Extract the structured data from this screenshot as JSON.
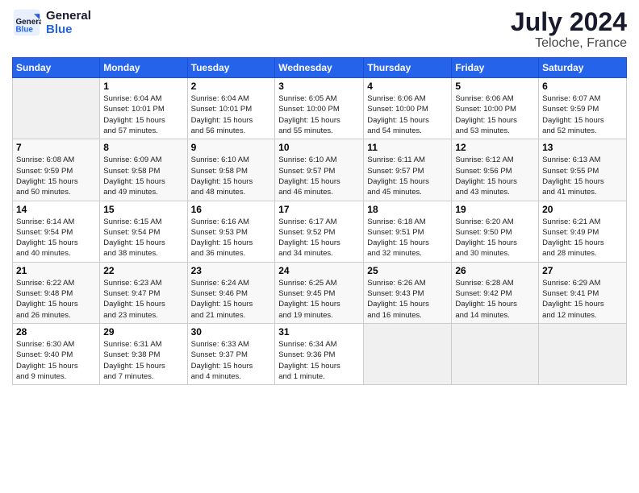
{
  "logo": {
    "line1": "General",
    "line2": "Blue"
  },
  "title": "July 2024",
  "location": "Teloche, France",
  "weekdays": [
    "Sunday",
    "Monday",
    "Tuesday",
    "Wednesday",
    "Thursday",
    "Friday",
    "Saturday"
  ],
  "weeks": [
    [
      {
        "day": "",
        "info": ""
      },
      {
        "day": "1",
        "info": "Sunrise: 6:04 AM\nSunset: 10:01 PM\nDaylight: 15 hours\nand 57 minutes."
      },
      {
        "day": "2",
        "info": "Sunrise: 6:04 AM\nSunset: 10:01 PM\nDaylight: 15 hours\nand 56 minutes."
      },
      {
        "day": "3",
        "info": "Sunrise: 6:05 AM\nSunset: 10:00 PM\nDaylight: 15 hours\nand 55 minutes."
      },
      {
        "day": "4",
        "info": "Sunrise: 6:06 AM\nSunset: 10:00 PM\nDaylight: 15 hours\nand 54 minutes."
      },
      {
        "day": "5",
        "info": "Sunrise: 6:06 AM\nSunset: 10:00 PM\nDaylight: 15 hours\nand 53 minutes."
      },
      {
        "day": "6",
        "info": "Sunrise: 6:07 AM\nSunset: 9:59 PM\nDaylight: 15 hours\nand 52 minutes."
      }
    ],
    [
      {
        "day": "7",
        "info": "Sunrise: 6:08 AM\nSunset: 9:59 PM\nDaylight: 15 hours\nand 50 minutes."
      },
      {
        "day": "8",
        "info": "Sunrise: 6:09 AM\nSunset: 9:58 PM\nDaylight: 15 hours\nand 49 minutes."
      },
      {
        "day": "9",
        "info": "Sunrise: 6:10 AM\nSunset: 9:58 PM\nDaylight: 15 hours\nand 48 minutes."
      },
      {
        "day": "10",
        "info": "Sunrise: 6:10 AM\nSunset: 9:57 PM\nDaylight: 15 hours\nand 46 minutes."
      },
      {
        "day": "11",
        "info": "Sunrise: 6:11 AM\nSunset: 9:57 PM\nDaylight: 15 hours\nand 45 minutes."
      },
      {
        "day": "12",
        "info": "Sunrise: 6:12 AM\nSunset: 9:56 PM\nDaylight: 15 hours\nand 43 minutes."
      },
      {
        "day": "13",
        "info": "Sunrise: 6:13 AM\nSunset: 9:55 PM\nDaylight: 15 hours\nand 41 minutes."
      }
    ],
    [
      {
        "day": "14",
        "info": "Sunrise: 6:14 AM\nSunset: 9:54 PM\nDaylight: 15 hours\nand 40 minutes."
      },
      {
        "day": "15",
        "info": "Sunrise: 6:15 AM\nSunset: 9:54 PM\nDaylight: 15 hours\nand 38 minutes."
      },
      {
        "day": "16",
        "info": "Sunrise: 6:16 AM\nSunset: 9:53 PM\nDaylight: 15 hours\nand 36 minutes."
      },
      {
        "day": "17",
        "info": "Sunrise: 6:17 AM\nSunset: 9:52 PM\nDaylight: 15 hours\nand 34 minutes."
      },
      {
        "day": "18",
        "info": "Sunrise: 6:18 AM\nSunset: 9:51 PM\nDaylight: 15 hours\nand 32 minutes."
      },
      {
        "day": "19",
        "info": "Sunrise: 6:20 AM\nSunset: 9:50 PM\nDaylight: 15 hours\nand 30 minutes."
      },
      {
        "day": "20",
        "info": "Sunrise: 6:21 AM\nSunset: 9:49 PM\nDaylight: 15 hours\nand 28 minutes."
      }
    ],
    [
      {
        "day": "21",
        "info": "Sunrise: 6:22 AM\nSunset: 9:48 PM\nDaylight: 15 hours\nand 26 minutes."
      },
      {
        "day": "22",
        "info": "Sunrise: 6:23 AM\nSunset: 9:47 PM\nDaylight: 15 hours\nand 23 minutes."
      },
      {
        "day": "23",
        "info": "Sunrise: 6:24 AM\nSunset: 9:46 PM\nDaylight: 15 hours\nand 21 minutes."
      },
      {
        "day": "24",
        "info": "Sunrise: 6:25 AM\nSunset: 9:45 PM\nDaylight: 15 hours\nand 19 minutes."
      },
      {
        "day": "25",
        "info": "Sunrise: 6:26 AM\nSunset: 9:43 PM\nDaylight: 15 hours\nand 16 minutes."
      },
      {
        "day": "26",
        "info": "Sunrise: 6:28 AM\nSunset: 9:42 PM\nDaylight: 15 hours\nand 14 minutes."
      },
      {
        "day": "27",
        "info": "Sunrise: 6:29 AM\nSunset: 9:41 PM\nDaylight: 15 hours\nand 12 minutes."
      }
    ],
    [
      {
        "day": "28",
        "info": "Sunrise: 6:30 AM\nSunset: 9:40 PM\nDaylight: 15 hours\nand 9 minutes."
      },
      {
        "day": "29",
        "info": "Sunrise: 6:31 AM\nSunset: 9:38 PM\nDaylight: 15 hours\nand 7 minutes."
      },
      {
        "day": "30",
        "info": "Sunrise: 6:33 AM\nSunset: 9:37 PM\nDaylight: 15 hours\nand 4 minutes."
      },
      {
        "day": "31",
        "info": "Sunrise: 6:34 AM\nSunset: 9:36 PM\nDaylight: 15 hours\nand 1 minute."
      },
      {
        "day": "",
        "info": ""
      },
      {
        "day": "",
        "info": ""
      },
      {
        "day": "",
        "info": ""
      }
    ]
  ]
}
